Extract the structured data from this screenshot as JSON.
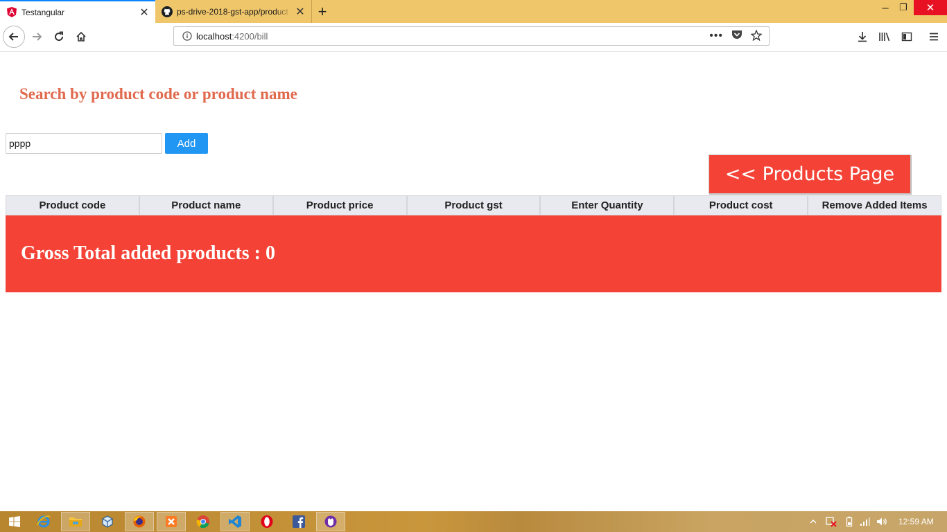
{
  "browser": {
    "tabs": [
      {
        "title": "Testangular",
        "favicon": "angular-icon",
        "active": true
      },
      {
        "title": "ps-drive-2018-gst-app/product",
        "favicon": "github-icon",
        "active": false
      }
    ],
    "url_host": "localhost",
    "url_path": ":4200/bill"
  },
  "page": {
    "search_heading": "Search by product code or product name",
    "search_value": "pppp",
    "add_label": "Add",
    "products_page_label": "<< Products Page",
    "table_columns": [
      "Product code",
      "Product name",
      "Product price",
      "Product gst",
      "Enter Quantity",
      "Product cost",
      "Remove Added Items"
    ],
    "gross_total_text": "Gross Total added products : 0"
  },
  "colors": {
    "heading": "#e06a4e",
    "add_button": "#2196f3",
    "accent_red": "#f44336",
    "table_header_bg": "#e9eaef"
  },
  "taskbar": {
    "apps": [
      "windows-start-icon",
      "internet-explorer-icon",
      "file-explorer-icon",
      "3d-box-icon",
      "firefox-icon",
      "xampp-icon",
      "chrome-icon",
      "vscode-icon",
      "opera-icon",
      "facebook-icon",
      "purple-app-icon"
    ],
    "clock": "12:59 AM"
  }
}
